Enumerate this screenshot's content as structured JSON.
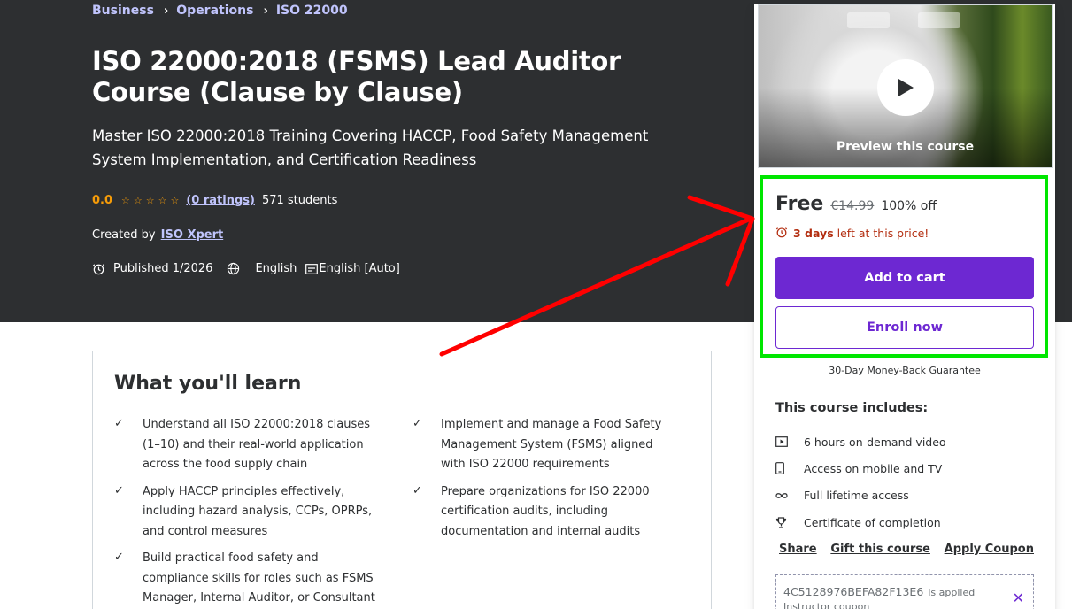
{
  "breadcrumb": [
    "Business",
    "Operations",
    "ISO 22000"
  ],
  "course": {
    "title": "ISO 22000:2018 (FSMS) Lead Auditor Course (Clause by Clause)",
    "subtitle": "Master ISO 22000:2018 Training Covering HACCP, Food Safety Management System Implementation, and Certification Readiness",
    "rating": "0.0",
    "ratings_link": "(0 ratings)",
    "students": "571 students",
    "created_by_label": "Created by",
    "instructor": "ISO Xpert",
    "published": "Published 1/2026",
    "language": "English",
    "captions": "English [Auto]"
  },
  "learn": {
    "title": "What you'll learn",
    "left": [
      "Understand all ISO 22000:2018 clauses (1–10) and their real-world application across the food supply chain",
      "Apply HACCP principles effectively, including hazard analysis, CCPs, OPRPs, and control measures",
      "Build practical food safety and compliance skills for roles such as FSMS Manager, Internal Auditor, or Consultant"
    ],
    "right": [
      "Implement and manage a Food Safety Management System (FSMS) aligned with ISO 22000 requirements",
      "Prepare organizations for ISO 22000 certification audits, including documentation and internal audits"
    ]
  },
  "sidebar": {
    "preview_label": "Preview this course",
    "price": "Free",
    "original_price": "€14.99",
    "discount": "100% off",
    "timer_bold": "3 days",
    "timer_rest": "left at this price!",
    "add_to_cart": "Add to cart",
    "enroll_now": "Enroll now",
    "guarantee": "30-Day Money-Back Guarantee",
    "includes_title": "This course includes:",
    "includes": [
      {
        "icon": "video-icon",
        "text": "6 hours on-demand video"
      },
      {
        "icon": "mobile-icon",
        "text": "Access on mobile and TV"
      },
      {
        "icon": "infinity-icon",
        "text": "Full lifetime access"
      },
      {
        "icon": "trophy-icon",
        "text": "Certificate of completion"
      }
    ],
    "links": [
      "Share",
      "Gift this course",
      "Apply Coupon"
    ],
    "coupon_code": "4C5128976BEFA82F13E6",
    "coupon_applied": "is applied",
    "coupon_sub": "Instructor coupon"
  },
  "colors": {
    "hero_bg": "#2d2f31",
    "link_purple": "#c0c4fc",
    "star": "#f69c08",
    "primary": "#6d28d2",
    "urgent": "#b32d0f",
    "highlight": "#00e600",
    "arrow": "#ff0000"
  }
}
